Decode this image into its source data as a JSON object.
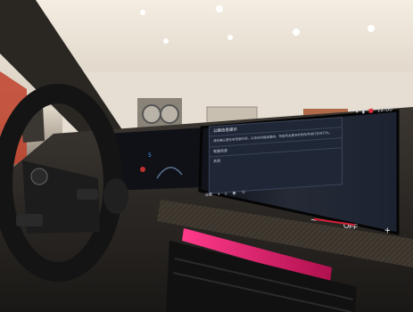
{
  "screen": {
    "time": "12:00",
    "dialog_title": "公路信息提示",
    "dialog_body": "请在确认是在有驾驶时间，以及在对路线面向，驾驶员会更多的危险并进行应对行为。",
    "dialog_item_1": "驾驶信息",
    "dialog_item_2": "关闭",
    "bottom_label": "设置",
    "climate_label": "OFF",
    "climate_minus": "−",
    "climate_plus": "+"
  },
  "colors": {
    "ambient_light": "#e0206e",
    "screen_bg": "#1b2030",
    "climate_red": "#d8203a"
  }
}
